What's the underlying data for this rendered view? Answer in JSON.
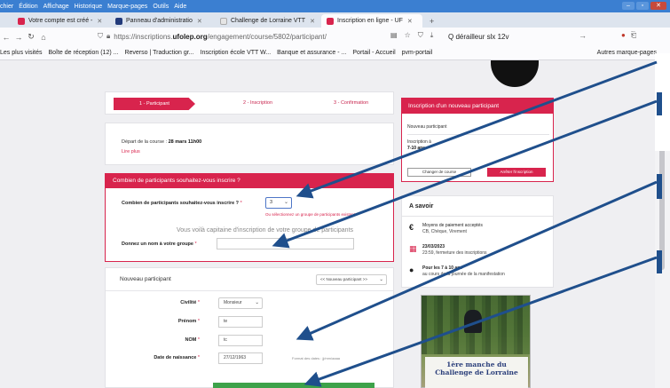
{
  "menubar": {
    "items": [
      "chier",
      "Édition",
      "Affichage",
      "Historique",
      "Marque-pages",
      "Outils",
      "Aide"
    ]
  },
  "tabs": [
    {
      "label": "Votre compte est créé - ",
      "icon_color": "#d8244d"
    },
    {
      "label": "Panneau d'administratio",
      "icon_color": "#223a7a"
    },
    {
      "label": "Challenge de Lorraine VTT",
      "icon_color": "#e5e5e5"
    },
    {
      "label": "Inscription en ligne - UF",
      "icon_color": "#d8244d",
      "active": true
    }
  ],
  "nav": {
    "url_prefix": "https://inscriptions.",
    "url_host": "ufolep.org",
    "url_path": "/engagement/course/5802/participant/",
    "search": "Q dérailleur slx 12v"
  },
  "bookmarks": {
    "items": [
      "Les plus visités",
      "Boîte de réception (12) ...",
      "Reverso | Traduction gr...",
      "Inscription école VTT W...",
      "Banque et assurance - ...",
      "Portail - Accueil",
      "pvm-portail"
    ],
    "right": "Autres marque-pages"
  },
  "steps": {
    "step1": "1 - Participant",
    "step2": "2 - Inscription",
    "step3": "3 - Confirmation"
  },
  "depart": {
    "label": "Départ de la course :",
    "date": "28 mars 11h00",
    "link": "Lire plus"
  },
  "combien": {
    "header": "Combien de participants souhaitez-vous inscrire ?",
    "question": "Combien de participants souhaitez-vous inscrire ?",
    "value": "3",
    "hint": "Ou sélectionnez un groupe de participants existant",
    "caption": "Vous voilà capitaine d'inscription de votre groupe de participants",
    "group_label": "Donnez un nom à votre groupe"
  },
  "nouveau": {
    "header": "Nouveau participant",
    "select": "<< Nouveau participant >>",
    "fields": {
      "civilite_label": "Civilité",
      "civilite_value": "Monsieur",
      "prenom_label": "Prénom",
      "prenom_value": "te",
      "nom_label": "NOM",
      "nom_value": "tc",
      "naissance_label": "Date de naissance",
      "naissance_value": "27/12/1963",
      "naissance_hint": "Format des dates : jj/mm/aaaa"
    }
  },
  "inscription_panel": {
    "header": "Inscription d'un nouveau participant",
    "np": "Nouveau participant",
    "insc_a": "Inscription à",
    "age": "7-10 ans",
    "btn_change": "Changer de course",
    "btn_cancel": "Arrêter l'inscription"
  },
  "asavoir": {
    "header": "A savoir",
    "rows": [
      {
        "t1": "Moyens de paiement acceptés",
        "t2": "CB, Chèque, Virement"
      },
      {
        "t1": "23/03/2023",
        "t2": "23:59, fermeture des inscriptions"
      },
      {
        "t1": "Pour les 7 à 10 ans",
        "t2": "au cours de la journée de la manifestation"
      }
    ]
  },
  "promo": {
    "line1": "1ère manche du",
    "line2": "Challenge de Lorraine"
  }
}
